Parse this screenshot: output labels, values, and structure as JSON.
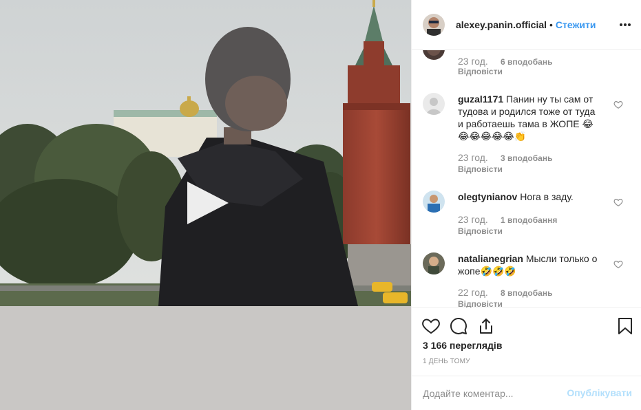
{
  "post": {
    "username": "alexey.panin.official",
    "separator": "•",
    "follow_label": "Стежити",
    "more_icon": "more-horizontal-icon"
  },
  "comments": [
    {
      "username": "",
      "text": "",
      "time": "23 год.",
      "likes": "6 вподобань",
      "reply": "Відповісти"
    },
    {
      "username": "guzal1171",
      "text": "Панин ну ты сам от тудова и родился тоже от туда и работаешь тама в ЖОПЕ 😂😂😂😂😂😂👏",
      "time": "23 год.",
      "likes": "3 вподобань",
      "reply": "Відповісти"
    },
    {
      "username": "olegtynianov",
      "text": "Нога в заду.",
      "time": "23 год.",
      "likes": "1 вподобання",
      "reply": "Відповісти"
    },
    {
      "username": "natalianegrian",
      "text": "Мысли только о жопе🤣🤣🤣",
      "time": "22 год.",
      "likes": "8 вподобань",
      "reply": "Відповісти"
    }
  ],
  "actions": {
    "like_icon": "heart-icon",
    "comment_icon": "comment-icon",
    "share_icon": "share-icon",
    "save_icon": "bookmark-icon",
    "views": "3 166 переглядів",
    "time_ago": "1 ДЕНЬ ТОМУ"
  },
  "add_comment": {
    "placeholder": "Додайте коментар...",
    "post_label": "Опублікувати"
  },
  "colors": {
    "link_blue": "#3897f0",
    "post_disabled": "#b2dffc",
    "muted_text": "#8e8e8e",
    "border": "#efefef"
  }
}
